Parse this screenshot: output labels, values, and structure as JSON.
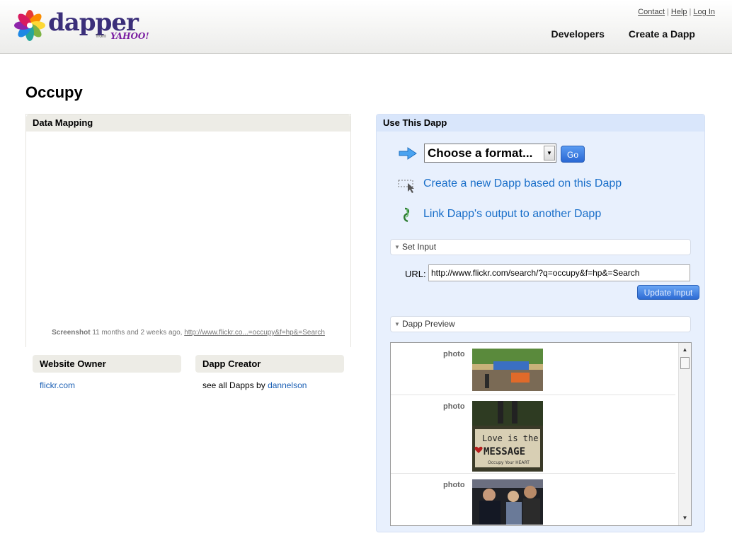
{
  "header": {
    "logo": {
      "word": "dapper",
      "from": "from",
      "yahoo": "YAHOO!"
    },
    "top_links": [
      "Contact",
      "Help",
      "Log In"
    ],
    "nav": [
      "Developers",
      "Create a Dapp"
    ]
  },
  "page_title": "Occupy",
  "data_mapping": {
    "title": "Data Mapping",
    "caption_label": "Screenshot",
    "caption_time": "11 months and 2 weeks ago,",
    "caption_link": "http://www.flickr.co...=occupy&f=hp&=Search"
  },
  "website_owner": {
    "title": "Website Owner",
    "link": "flickr.com"
  },
  "dapp_creator": {
    "title": "Dapp Creator",
    "text": "see all Dapps by",
    "link": "dannelson"
  },
  "use_dapp": {
    "title": "Use This Dapp",
    "format_select": "Choose a format...",
    "go_label": "Go",
    "create_new": "Create a new Dapp based on this Dapp",
    "link_output": "Link Dapp's output to another Dapp",
    "set_input": "Set Input",
    "url_label": "URL:",
    "url_value": "http://www.flickr.com/search/?q=occupy&f=hp&=Search",
    "update_label": "Update Input",
    "preview_title": "Dapp Preview",
    "rows": [
      {
        "label": "photo"
      },
      {
        "label": "photo",
        "sign_line1": "Love is the",
        "sign_line2": "MESSAGE",
        "sign_line3": "Occupy Your HEART"
      },
      {
        "label": "photo"
      }
    ]
  },
  "colors": {
    "accent": "#1a6fc9",
    "brand": "#3b2f7a",
    "panel": "#e8f0fd"
  }
}
